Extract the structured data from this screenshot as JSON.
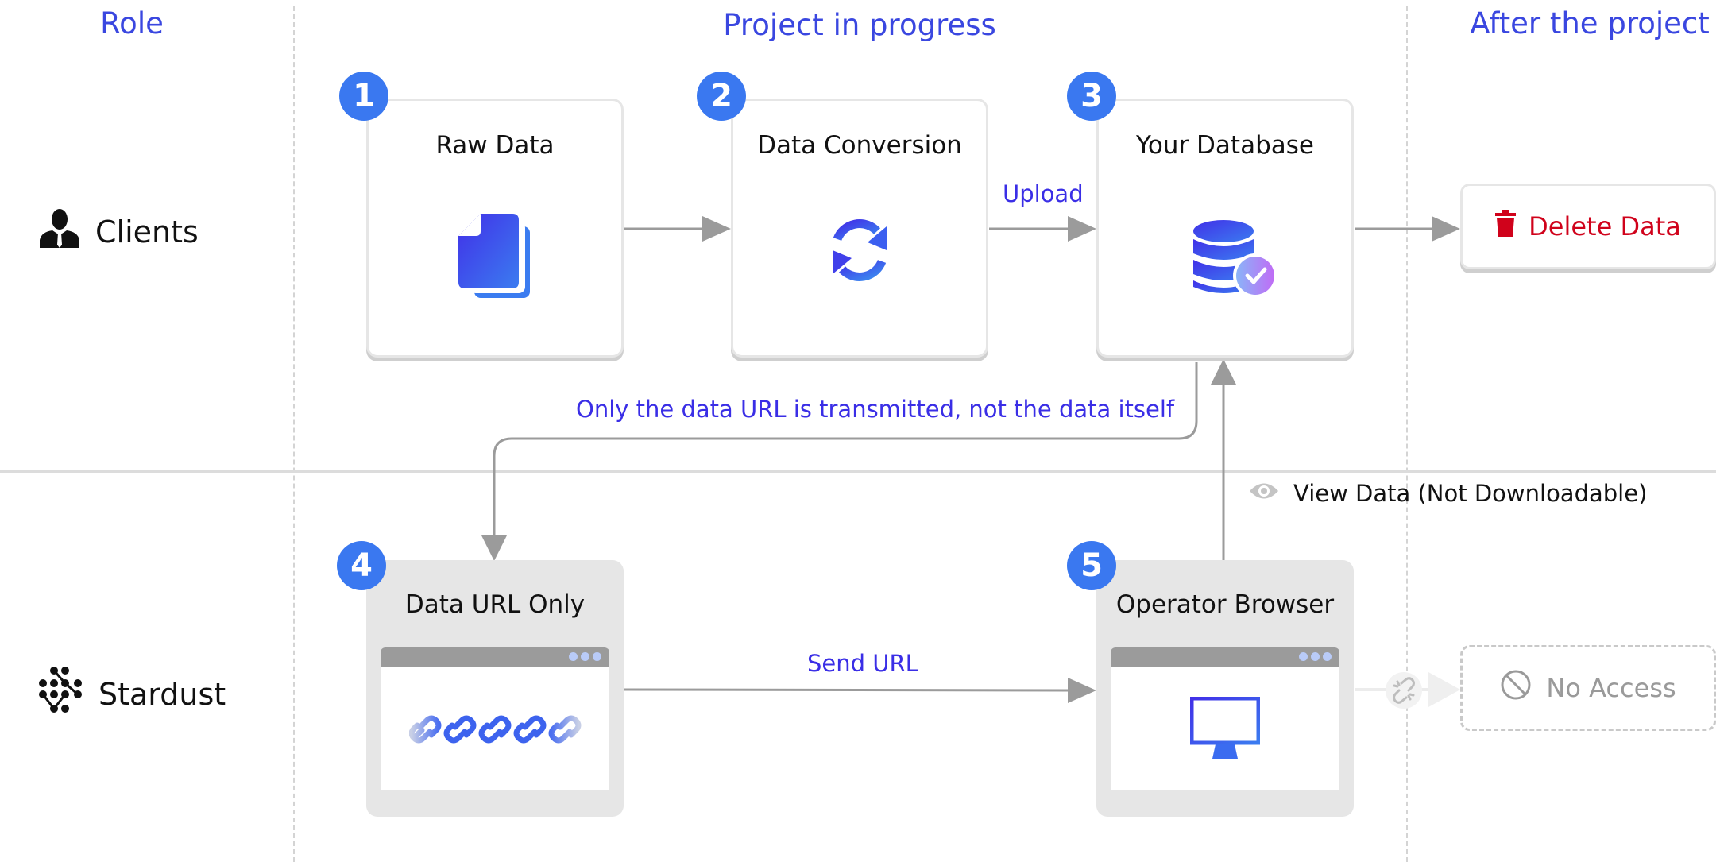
{
  "columns": {
    "role": "Role",
    "in_progress": "Project in progress",
    "after": "After the project"
  },
  "roles": [
    {
      "label": "Clients",
      "icon": "user-icon"
    },
    {
      "label": "Stardust",
      "icon": "stardust-logo-icon"
    }
  ],
  "steps": [
    {
      "number": "1",
      "title": "Raw Data",
      "icon": "documents-icon"
    },
    {
      "number": "2",
      "title": "Data Conversion",
      "icon": "sync-icon"
    },
    {
      "number": "3",
      "title": "Your Database",
      "icon": "database-check-icon"
    },
    {
      "number": "4",
      "title": "Data URL Only",
      "icon": "link-chain-icon"
    },
    {
      "number": "5",
      "title": "Operator Browser",
      "icon": "monitor-icon"
    }
  ],
  "flow_labels": {
    "upload": "Upload",
    "url_only_note": "Only the data URL is transmitted, not the data itself",
    "send_url": "Send URL",
    "view_data": "View Data (Not Downloadable)"
  },
  "after_actions": {
    "delete": {
      "label": "Delete Data",
      "icon": "trash-icon",
      "color": "#d0021b"
    },
    "no_access": {
      "label": "No Access",
      "icon": "prohibited-icon",
      "color": "#9a9a9a"
    }
  },
  "colors": {
    "accent": "#3a47e0",
    "badge": "#3a78f0",
    "flow_label": "#3a2ee6",
    "arrow": "#9b9b9b"
  }
}
